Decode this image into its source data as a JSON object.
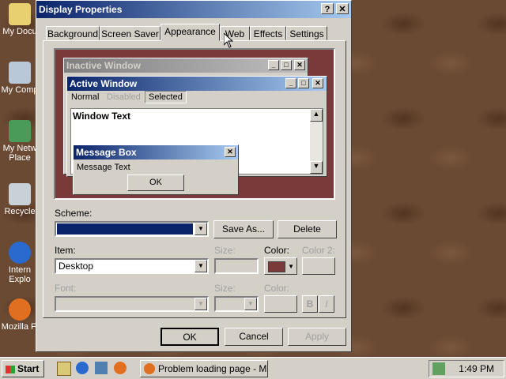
{
  "desktop_icons": [
    {
      "label": "My Docu",
      "icon": "folder-icon"
    },
    {
      "label": "My Comp",
      "icon": "computer-icon"
    },
    {
      "label": "My Netw Place",
      "icon": "network-icon"
    },
    {
      "label": "Recycle",
      "icon": "recycle-bin-icon"
    },
    {
      "label": "Intern Explo",
      "icon": "ie-icon"
    },
    {
      "label": "Mozilla Fi",
      "icon": "firefox-icon"
    }
  ],
  "dialog": {
    "title": "Display Properties",
    "tabs": [
      "Background",
      "Screen Saver",
      "Appearance",
      "Web",
      "Effects",
      "Settings"
    ],
    "preview": {
      "inactive_title": "Inactive Window",
      "active_title": "Active Window",
      "menu": [
        "Normal",
        "Disabled",
        "Selected"
      ],
      "window_text": "Window Text",
      "message_title": "Message Box",
      "message_text": "Message Text",
      "ok": "OK"
    },
    "scheme_label": "Scheme:",
    "scheme_value": "",
    "save_as": "Save As...",
    "delete": "Delete",
    "item_label": "Item:",
    "item_value": "Desktop",
    "size_label": "Size:",
    "color_label": "Color:",
    "color2_label": "Color 2:",
    "font_label": "Font:",
    "font_size_label": "Size:",
    "font_color_label": "Color:",
    "bold": "B",
    "italic": "I",
    "ok": "OK",
    "cancel": "Cancel",
    "apply": "Apply",
    "selected_color": "#7a3a3a"
  },
  "taskbar": {
    "start": "Start",
    "task": "Problem loading page - M...",
    "clock": "1:49 PM"
  }
}
